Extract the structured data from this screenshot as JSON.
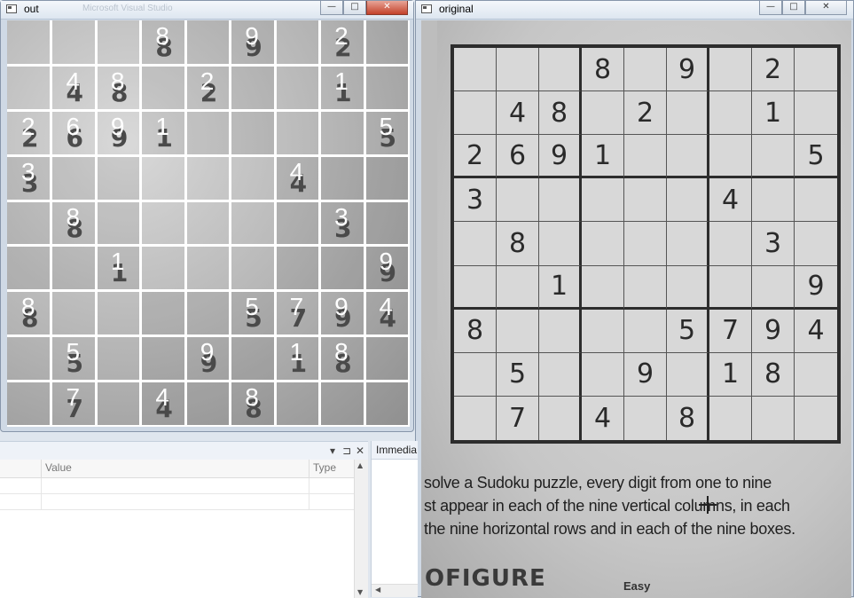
{
  "out_window": {
    "title": "out",
    "ghost_title": "Microsoft Visual Studio",
    "buttons": {
      "minimize": "—",
      "maximize": "□",
      "close": "✕"
    },
    "paper_digits": [
      [
        "",
        "",
        "",
        "8",
        "",
        "9",
        "",
        "2",
        ""
      ],
      [
        "",
        "4",
        "8",
        "",
        "2",
        "",
        "",
        "1",
        ""
      ],
      [
        "2",
        "6",
        "9",
        "1",
        "",
        "",
        "",
        "",
        "5"
      ],
      [
        "3",
        "",
        "",
        "",
        "",
        "",
        "4",
        "",
        ""
      ],
      [
        "",
        "8",
        "",
        "",
        "",
        "",
        "",
        "3",
        ""
      ],
      [
        "",
        "",
        "1",
        "",
        "",
        "",
        "",
        "",
        "9"
      ],
      [
        "8",
        "",
        "",
        "",
        "",
        "5",
        "7",
        "9",
        "4"
      ],
      [
        "",
        "5",
        "",
        "",
        "9",
        "",
        "1",
        "8",
        ""
      ],
      [
        "",
        "7",
        "",
        "4",
        "",
        "8",
        "",
        "",
        ""
      ]
    ],
    "recognized_digits": [
      [
        "",
        "",
        "",
        "8",
        "",
        "9",
        "",
        "2",
        ""
      ],
      [
        "",
        "4",
        "8",
        "",
        "2",
        "",
        "",
        "1",
        ""
      ],
      [
        "2",
        "6",
        "9",
        "1",
        "",
        "",
        "",
        "",
        "5"
      ],
      [
        "3",
        "",
        "",
        "",
        "",
        "",
        "4",
        "",
        ""
      ],
      [
        "",
        "8",
        "",
        "",
        "",
        "",
        "",
        "3",
        ""
      ],
      [
        "",
        "",
        "1",
        "",
        "",
        "",
        "",
        "",
        "9"
      ],
      [
        "8",
        "",
        "",
        "",
        "",
        "5",
        "7",
        "9",
        "4"
      ],
      [
        "",
        "5",
        "",
        "",
        "9",
        "",
        "1",
        "8",
        ""
      ],
      [
        "",
        "7",
        "",
        "4",
        "",
        "8",
        "",
        "",
        ""
      ]
    ]
  },
  "original_window": {
    "title": "original",
    "buttons": {
      "minimize": "—",
      "maximize": "□",
      "close": "✕"
    },
    "grid": [
      [
        "",
        "",
        "",
        "8",
        "",
        "9",
        "",
        "2",
        ""
      ],
      [
        "",
        "4",
        "8",
        "",
        "2",
        "",
        "",
        "1",
        ""
      ],
      [
        "2",
        "6",
        "9",
        "1",
        "",
        "",
        "",
        "",
        "5"
      ],
      [
        "3",
        "",
        "",
        "",
        "",
        "",
        "4",
        "",
        ""
      ],
      [
        "",
        "8",
        "",
        "",
        "",
        "",
        "",
        "3",
        ""
      ],
      [
        "",
        "",
        "1",
        "",
        "",
        "",
        "",
        "",
        "9"
      ],
      [
        "8",
        "",
        "",
        "",
        "",
        "5",
        "7",
        "9",
        "4"
      ],
      [
        "",
        "5",
        "",
        "",
        "9",
        "",
        "1",
        "8",
        ""
      ],
      [
        "",
        "7",
        "",
        "4",
        "",
        "8",
        "",
        "",
        ""
      ]
    ],
    "instructions": [
      "solve a Sudoku puzzle, every digit from one to nine",
      "st appear in each of the nine vertical columns, in each",
      "the nine horizontal rows and in each of the nine boxes."
    ],
    "footer_heading": "OFIGURE",
    "difficulty": "Easy"
  },
  "watch_panel": {
    "buttons": {
      "dropdown": "▾",
      "pin": "⊐",
      "close": "✕"
    },
    "columns": [
      "",
      "Value",
      "Type"
    ]
  },
  "immediate_panel": {
    "title": "Immedia"
  }
}
